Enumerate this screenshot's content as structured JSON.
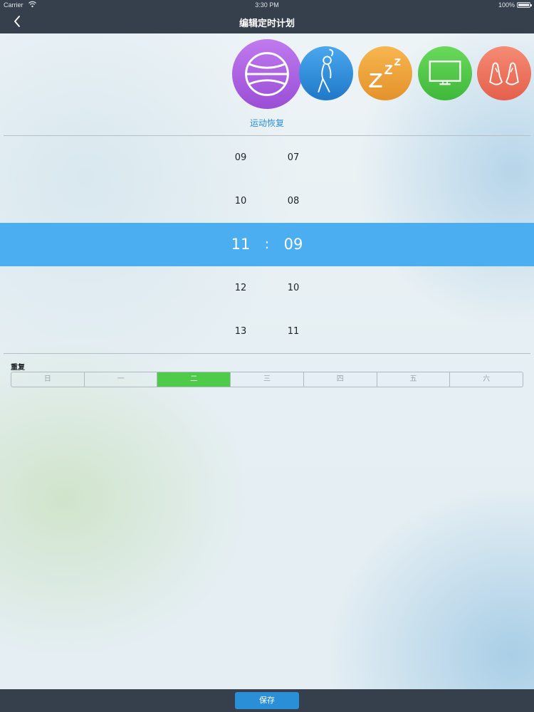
{
  "status_bar": {
    "carrier": "Carrier",
    "time": "3:30 PM",
    "battery": "100%"
  },
  "nav": {
    "title": "编辑定时计划",
    "back_icon": "chevron-left-icon"
  },
  "modes": {
    "selected_label": "运动恢复",
    "items": [
      {
        "icon": "basketball-icon",
        "color": "#b05fe0",
        "selected": true
      },
      {
        "icon": "stretching-person-icon",
        "color": "#2f8fdc",
        "selected": false
      },
      {
        "icon": "sleep-zzz-icon",
        "color": "#f0a53a",
        "selected": false
      },
      {
        "icon": "tv-icon",
        "color": "#54cc47",
        "selected": false
      },
      {
        "icon": "hands-icon",
        "color": "#f07560",
        "selected": false
      }
    ]
  },
  "picker": {
    "hours": [
      "09",
      "10",
      "11",
      "12",
      "13"
    ],
    "minutes": [
      "07",
      "08",
      "09",
      "10",
      "11"
    ],
    "selected_hour": "11",
    "selected_minute": "09",
    "separator": ":"
  },
  "repeat": {
    "label": "重复",
    "days": [
      "日",
      "一",
      "二",
      "三",
      "四",
      "五",
      "六"
    ],
    "active_day": "二"
  },
  "bottom": {
    "save_label": "保存"
  },
  "colors": {
    "nav_bg": "#36404c",
    "accent": "#2a8fd6",
    "picker_highlight": "#4aaef0",
    "day_active": "#4fcb4a"
  }
}
